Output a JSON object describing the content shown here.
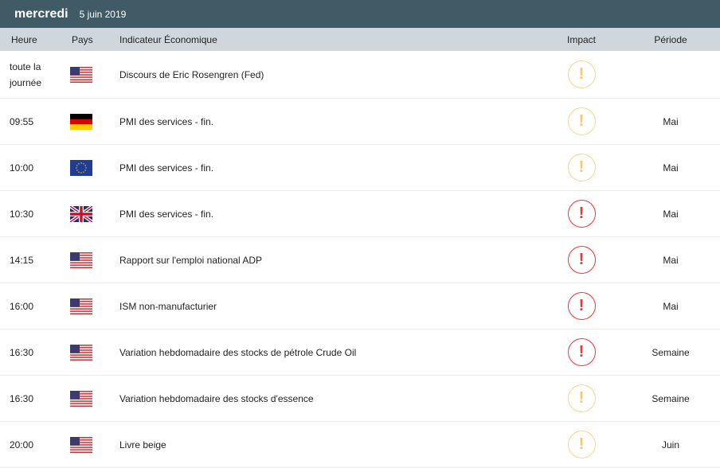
{
  "header": {
    "day": "mercredi",
    "date": "5 juin 2019"
  },
  "columns": {
    "time": "Heure",
    "country": "Pays",
    "indicator": "Indicateur Économique",
    "impact": "Impact",
    "period": "Période"
  },
  "colors": {
    "medium": "#f9c56a",
    "high": "#e53935",
    "header": "#405b66"
  },
  "rows": [
    {
      "time": "toute la journée",
      "flag": "us",
      "indicator": "Discours de Eric Rosengren (Fed)",
      "impact": "medium",
      "impact_symbol": "!",
      "period": ""
    },
    {
      "time": "09:55",
      "flag": "de",
      "indicator": "PMI des services - fin.",
      "impact": "medium",
      "impact_symbol": "!",
      "period": "Mai"
    },
    {
      "time": "10:00",
      "flag": "eu",
      "indicator": "PMI des services - fin.",
      "impact": "medium",
      "impact_symbol": "!",
      "period": "Mai"
    },
    {
      "time": "10:30",
      "flag": "gb",
      "indicator": "PMI des services - fin.",
      "impact": "high",
      "impact_symbol": "!",
      "period": "Mai"
    },
    {
      "time": "14:15",
      "flag": "us",
      "indicator": "Rapport sur l'emploi national ADP",
      "impact": "high",
      "impact_symbol": "!",
      "period": "Mai"
    },
    {
      "time": "16:00",
      "flag": "us",
      "indicator": "ISM non-manufacturier",
      "impact": "high",
      "impact_symbol": "!",
      "period": "Mai"
    },
    {
      "time": "16:30",
      "flag": "us",
      "indicator": "Variation hebdomadaire des stocks de pétrole Crude Oil",
      "impact": "high",
      "impact_symbol": "!",
      "period": "Semaine"
    },
    {
      "time": "16:30",
      "flag": "us",
      "indicator": "Variation hebdomadaire des stocks d'essence",
      "impact": "medium",
      "impact_symbol": "!",
      "period": "Semaine"
    },
    {
      "time": "20:00",
      "flag": "us",
      "indicator": "Livre beige",
      "impact": "medium",
      "impact_symbol": "!",
      "period": "Juin"
    }
  ]
}
